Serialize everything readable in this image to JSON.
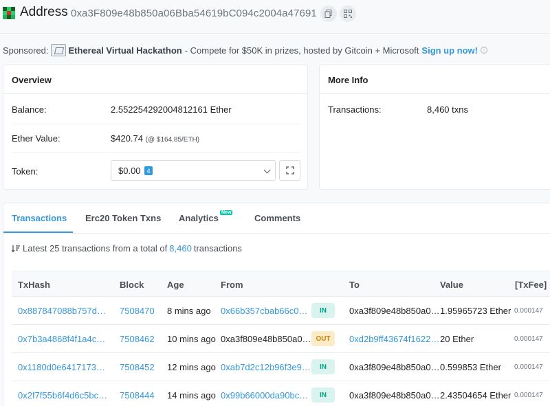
{
  "header": {
    "title": "Address",
    "address": "0xa3F809e48b850a06Bba54619bC094c2004a47691",
    "copy_icon": "copy-icon",
    "qr_icon": "qr-code-icon"
  },
  "sponsored": {
    "label": "Sponsored:",
    "name": "Ethereal Virtual Hackathon",
    "text": "- Compete for $50K in prizes, hosted by Gitcoin + Microsoft",
    "cta": "Sign up now!",
    "info_icon": "i"
  },
  "overview": {
    "title": "Overview",
    "balance_label": "Balance:",
    "balance_value": "2.552254292004812161 Ether",
    "ether_value_label": "Ether Value:",
    "ether_value": "$420.74",
    "ether_price": "(@ $164.85/ETH)",
    "token_label": "Token:",
    "token_value": "$0.00",
    "token_count": "4"
  },
  "more_info": {
    "title": "More Info",
    "transactions_label": "Transactions:",
    "transactions_value": "8,460 txns"
  },
  "tabs": [
    {
      "label": "Transactions",
      "active": true
    },
    {
      "label": "Erc20 Token Txns",
      "active": false
    },
    {
      "label": "Analytics",
      "badge": "New",
      "active": false
    },
    {
      "label": "Comments",
      "active": false
    }
  ],
  "summary": {
    "prefix": "Latest 25 transactions from a total of",
    "count": "8,460",
    "suffix": "transactions"
  },
  "table": {
    "headers": [
      "TxHash",
      "Block",
      "Age",
      "From",
      "To",
      "Value",
      "[TxFee]"
    ],
    "rows": [
      {
        "hash": "0x887847088b757d…",
        "block": "7508470",
        "age": "8 mins ago",
        "from": "0x66b357cbab66c0…",
        "dir": "IN",
        "to": "0xa3f809e48b850a0…",
        "value": "1.95965723 Ether",
        "fee": "0.000147"
      },
      {
        "hash": "0x7b3a4868f4f1a4c…",
        "block": "7508462",
        "age": "10 mins ago",
        "from": "0xa3f809e48b850a0…",
        "dir": "OUT",
        "to": "0xd2b9ff43674f1622…",
        "value": "20 Ether",
        "fee": "0.000147"
      },
      {
        "hash": "0x1180d0e6417173…",
        "block": "7508452",
        "age": "12 mins ago",
        "from": "0xab7d2c12b96f3e9…",
        "dir": "IN",
        "to": "0xa3f809e48b850a0…",
        "value": "0.599853 Ether",
        "fee": "0.000147"
      },
      {
        "hash": "0x2f7f55b6f4d6c5bc…",
        "block": "7508444",
        "age": "14 mins ago",
        "from": "0x99b66000da90bc…",
        "dir": "IN",
        "to": "0xa3f809e48b850a0…",
        "value": "2.43504654 Ether",
        "fee": "0.000147"
      }
    ]
  },
  "colors": {
    "accent": "#3498db",
    "in_badge_bg": "#d9f4ef",
    "out_badge_bg": "#fbebc7"
  }
}
